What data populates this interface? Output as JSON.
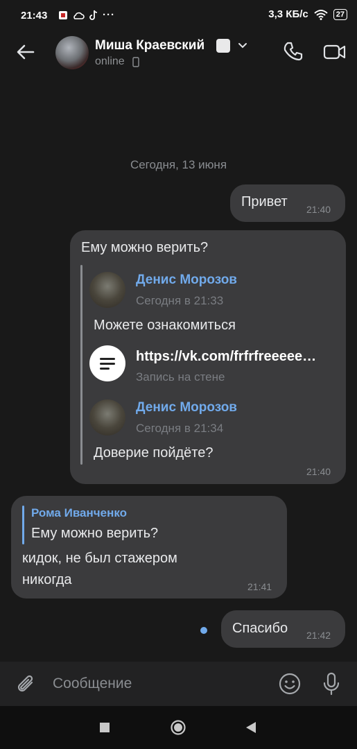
{
  "status_bar": {
    "time": "21:43",
    "speed": "3,3 КБ/с",
    "battery": "27"
  },
  "header": {
    "contact_name": "Миша Краевский",
    "status": "online",
    "icons": [
      "back-arrow-icon",
      "chevron-down-icon",
      "phone-call-icon",
      "video-call-icon"
    ]
  },
  "chat": {
    "date_divider": "Сегодня, 13 июня",
    "messages": [
      {
        "direction": "out",
        "text": "Привет",
        "time": "21:40"
      },
      {
        "direction": "out",
        "text": "Ему можно верить?",
        "time": "21:40",
        "forwarded": [
          {
            "author": "Денис Морозов",
            "date": "Сегодня в 21:33",
            "text": "Можете ознакомиться",
            "link": {
              "title": "https://vk.com/frfrfreeeee…",
              "subtitle": "Запись на стене"
            }
          },
          {
            "author": "Денис Морозов",
            "date": "Сегодня в 21:34",
            "text": "Доверие пойдёте?"
          }
        ]
      },
      {
        "direction": "in",
        "reply_author": "Рома Иванченко",
        "reply_text": "Ему можно верить?",
        "text_line1": "кидок, не был стажером",
        "text_line2": "никогда",
        "time": "21:41"
      },
      {
        "direction": "out",
        "text": "Спасибо",
        "time": "21:42",
        "unread": true
      }
    ]
  },
  "composer": {
    "placeholder": "Сообщение",
    "value": ""
  },
  "colors": {
    "background": "#191919",
    "bubble": "#3b3b3d",
    "accent": "#71aaeb",
    "composer": "#222223",
    "navbar": "#0f0f0f"
  }
}
